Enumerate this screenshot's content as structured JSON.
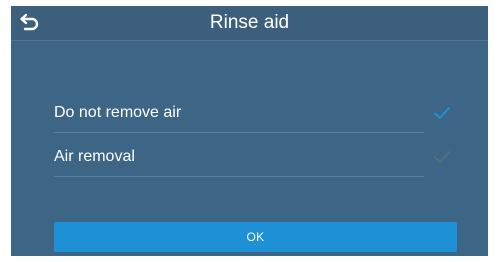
{
  "header": {
    "title": "Rinse aid",
    "back_icon": "back-arrow-icon"
  },
  "options": [
    {
      "label": "Do not remove air",
      "selected": true,
      "check_color": "#1e90d6",
      "icon": "check-icon"
    },
    {
      "label": "Air removal",
      "selected": false,
      "check_color": "#55707f",
      "icon": "check-icon"
    }
  ],
  "actions": {
    "ok_label": "OK"
  },
  "colors": {
    "background": "#3d6585",
    "header_background": "#3b5f7c",
    "accent": "#1e90d6"
  }
}
